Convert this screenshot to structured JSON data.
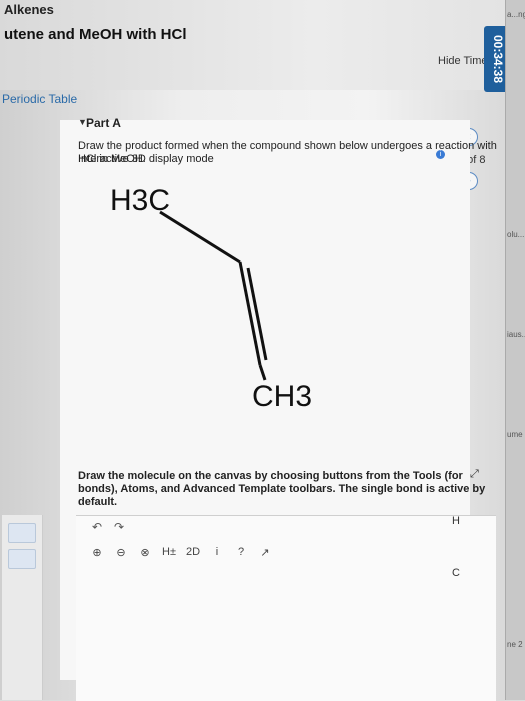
{
  "header": {
    "course": "Alkenes",
    "assignment": "utene and MeOH with HCl",
    "hide_timer": "Hide Timer",
    "timer": "00:34:38",
    "page": "6 of 8"
  },
  "sidebar": {
    "periodic_table": "Periodic Table"
  },
  "edge_labels": [
    "a...ng",
    "olu...",
    "iaus...",
    "ume",
    "ne 2"
  ],
  "part": {
    "label": "Part A",
    "question": "Draw the product formed when the compound shown below undergoes a reaction with HCl in MeOH.",
    "mode_link": "Interactive 3D display mode"
  },
  "molecule": {
    "left_atom": "H3C",
    "right_atom": "CH3"
  },
  "instructions": "Draw the molecule on the canvas by choosing buttons from the Tools (for bonds), Atoms, and Advanced Template toolbars. The single bond is active by default.",
  "toolbar": {
    "undo": "↶",
    "redo": "↷",
    "zoom_in": "⊕",
    "zoom_out": "⊖",
    "clear": "⊗",
    "h_toggle": "H±",
    "two_d": "2D",
    "info": "i",
    "help": "?",
    "expand": "↗"
  },
  "atoms_panel": [
    "H",
    "C"
  ],
  "colors": {
    "accent": "#1f5f9c",
    "link": "#2a6aa8",
    "info": "#3a7bd5"
  }
}
